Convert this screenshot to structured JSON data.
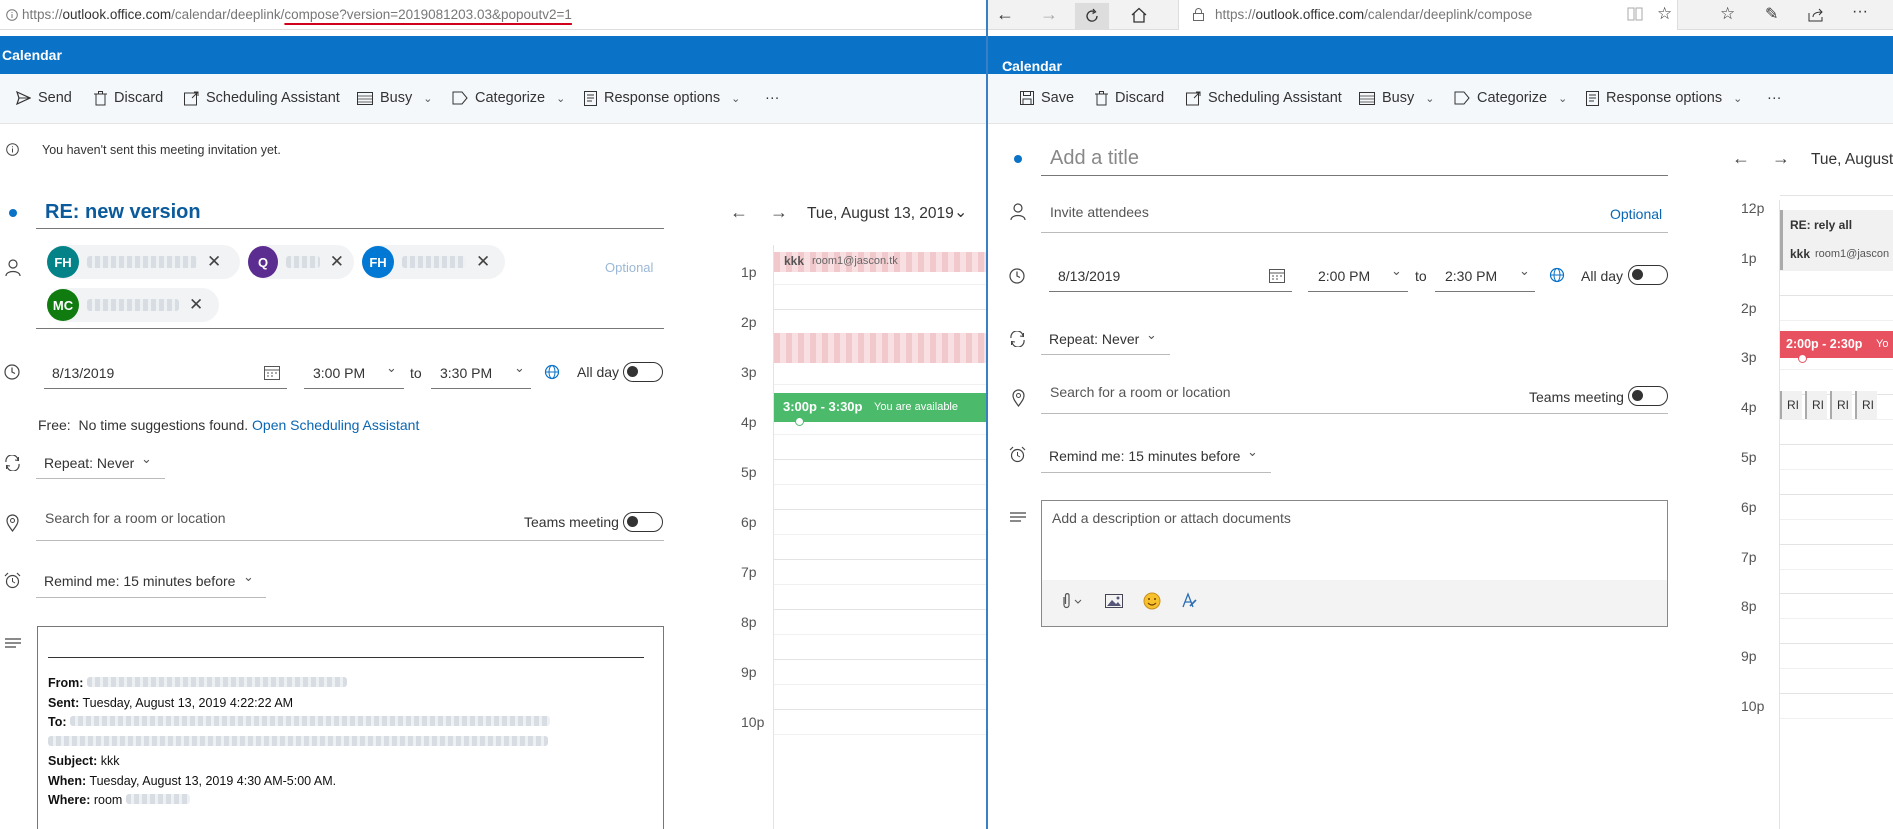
{
  "left": {
    "url": {
      "pre": "https://",
      "domain": "outlook.office.com",
      "path": "/calendar/deeplink/",
      "underlined": "compose?version=2019081203.03&popoutv2=1"
    },
    "app_title": "Calendar",
    "toolbar": {
      "send": "Send",
      "discard": "Discard",
      "scheduling": "Scheduling Assistant",
      "busy": "Busy",
      "categorize": "Categorize",
      "response": "Response options",
      "more": "···"
    },
    "info": "You haven't sent this meeting invitation yet.",
    "title": "RE: new version",
    "attendees": [
      {
        "initials": "FH",
        "color": "#038387"
      },
      {
        "initials": "Q",
        "color": "#5c2d91"
      },
      {
        "initials": "FH",
        "color": "#0078d4"
      },
      {
        "initials": "MC",
        "color": "#107c10"
      }
    ],
    "optional_label": "Optional",
    "date": "8/13/2019",
    "start": "3:00 PM",
    "to_label": "to",
    "end": "3:30 PM",
    "all_day": "All day",
    "free_label": "Free:",
    "no_suggestions": "No time suggestions found.",
    "open_scheduling": "Open Scheduling Assistant",
    "repeat": "Repeat:  Never",
    "location_placeholder": "Search for a room or location",
    "teams": "Teams meeting",
    "remind": "Remind me:  15 minutes before",
    "body": {
      "from_label": "From:",
      "sent_label": "Sent:",
      "sent_value": "Tuesday, August 13, 2019 4:22:22 AM",
      "to_label": "To:",
      "subject_label": "Subject:",
      "subject_value": "kkk",
      "when_label": "When:",
      "when_value": "Tuesday, August 13, 2019 4:30 AM-5:00 AM.",
      "where_label": "Where:",
      "where_value": "room"
    },
    "calendar": {
      "date_label": "Tue, August 13, 2019",
      "hours": [
        "1p",
        "2p",
        "3p",
        "4p",
        "5p",
        "6p",
        "7p",
        "8p",
        "9p",
        "10p"
      ],
      "event_kkk": {
        "title": "kkk",
        "room": "room1@jascon.tk"
      },
      "event_new": {
        "time": "3:00p - 3:30p",
        "status": "You are available"
      }
    }
  },
  "right": {
    "url": {
      "pre": "https://",
      "domain": "outlook.office.com",
      "path": "/calendar/deeplink/compose"
    },
    "app_title": "Calendar",
    "toolbar": {
      "save": "Save",
      "discard": "Discard",
      "scheduling": "Scheduling Assistant",
      "busy": "Busy",
      "categorize": "Categorize",
      "response": "Response options",
      "more": "···"
    },
    "title_placeholder": "Add a title",
    "invite_placeholder": "Invite attendees",
    "optional_label": "Optional",
    "date": "8/13/2019",
    "start": "2:00 PM",
    "to_label": "to",
    "end": "2:30 PM",
    "all_day": "All day",
    "repeat": "Repeat:  Never",
    "location_placeholder": "Search for a room or location",
    "teams": "Teams meeting",
    "remind": "Remind me:  15 minutes before",
    "description_placeholder": "Add a description or attach documents",
    "calendar": {
      "date_label": "Tue, August",
      "hours": [
        "12p",
        "1p",
        "2p",
        "3p",
        "4p",
        "5p",
        "6p",
        "7p",
        "8p",
        "9p",
        "10p"
      ],
      "event_rely": {
        "title": "RE: rely all",
        "sub": "kkk",
        "room": "room1@jascon"
      },
      "event_new": {
        "time": "2:00p - 2:30p",
        "tail": "Yo"
      },
      "mini_label": "RI"
    }
  },
  "colors": {
    "brand": "#0a72c7",
    "available": "#4cba6b",
    "busy": "#e8515f",
    "hatch": "#f1c9cd"
  }
}
